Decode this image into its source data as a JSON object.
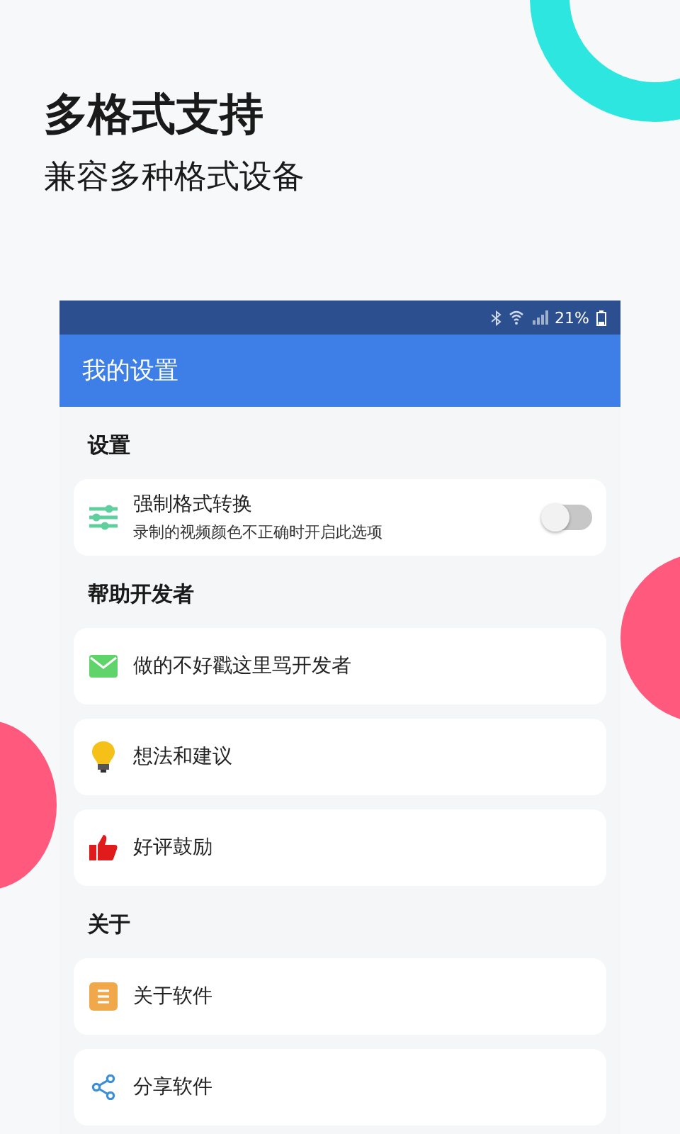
{
  "headline": "多格式支持",
  "subtitle": "兼容多种格式设备",
  "status_bar": {
    "battery": "21%"
  },
  "app_bar": {
    "title": "我的设置"
  },
  "sections": [
    {
      "title": "设置",
      "items": [
        {
          "kind": "toggle",
          "label": "强制格式转换",
          "description": "录制的视频颜色不正确时开启此选项",
          "on": false
        }
      ]
    },
    {
      "title": "帮助开发者",
      "items": [
        {
          "kind": "link",
          "label": "做的不好戳这里骂开发者"
        },
        {
          "kind": "link",
          "label": "想法和建议"
        },
        {
          "kind": "link",
          "label": "好评鼓励"
        }
      ]
    },
    {
      "title": "关于",
      "items": [
        {
          "kind": "link",
          "label": "关于软件"
        },
        {
          "kind": "link",
          "label": "分享软件"
        }
      ]
    }
  ]
}
